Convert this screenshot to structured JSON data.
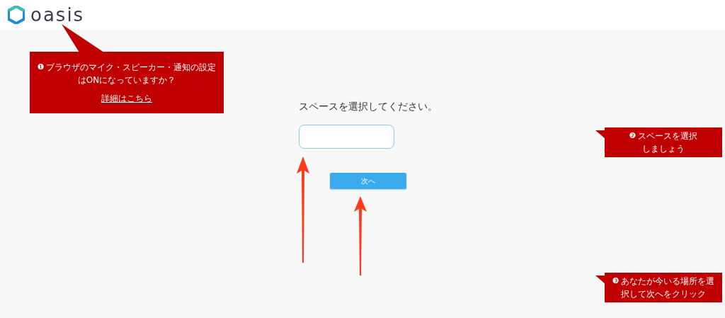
{
  "header": {
    "logo_text": "oasis"
  },
  "main": {
    "prompt": "スペースを選択してください。",
    "next_button": "次へ"
  },
  "callouts": [
    {
      "number": "❶",
      "lines": [
        "ブラウザのマイク・スピーカー・通知の設定",
        "はONになっていますか？"
      ],
      "link": "詳細はこちら"
    },
    {
      "number": "❷",
      "lines": [
        "スペースを選択",
        "しましょう"
      ]
    },
    {
      "number": "❸",
      "lines": [
        "あなたが今いる場所を選",
        "択して次へをクリック"
      ]
    }
  ]
}
